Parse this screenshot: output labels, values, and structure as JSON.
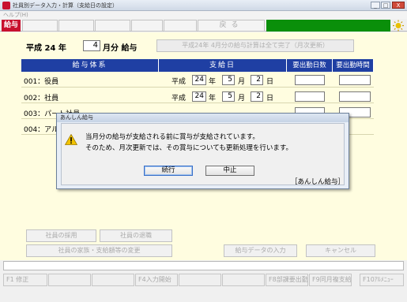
{
  "window": {
    "title": "社員別データ入力・計算（支給日の設定）",
    "menu_help": "ヘルプ(H)",
    "min": "_",
    "max": "□",
    "close": "X"
  },
  "toolbar": {
    "badge": "給与",
    "back_label": "戻る",
    "accent_color": "#0a8f0a"
  },
  "period": {
    "era": "平成",
    "year": "24",
    "year_unit": "年",
    "month": "4",
    "month_label": "月分 給与",
    "status": "平成24年 4月分の給与計算は全て完了（月次更新）"
  },
  "table": {
    "headers": {
      "system": "給与体系",
      "payday": "支給日",
      "days": "要出勤日数",
      "hours": "要出勤時間"
    },
    "rows": [
      {
        "name": "001：役員",
        "era": "平成",
        "year": "24",
        "month": "5",
        "day": "2"
      },
      {
        "name": "002：社員",
        "era": "平成",
        "year": "24",
        "month": "5",
        "day": "2"
      },
      {
        "name": "003：パート社員",
        "era": "",
        "year": "",
        "month": "",
        "day": ""
      },
      {
        "name": "004：アル",
        "era": "",
        "year": "",
        "month": "",
        "day": ""
      }
    ],
    "labels": {
      "year": "年",
      "month": "月",
      "day": "日"
    }
  },
  "actions": {
    "hire": "社員の採用",
    "retire": "社員の退職",
    "family": "社員の家族・支給額等の変更",
    "input": "給与データの入力",
    "cancel": "キャンセル"
  },
  "fkeys": [
    "F1 修正",
    "",
    "",
    "F4入力開始",
    "",
    "",
    "F8部課要出勤",
    "F9同月複支給",
    "F10ｱﾙﾒﾆｭｰ"
  ],
  "dialog": {
    "title": "あんしん給与",
    "line1": "当月分の給与が支給される前に賞与が支給されています。",
    "line2": "そのため、月次更新では、その賞与についても更新処理を行います。",
    "continue": "続行",
    "abort": "中止",
    "brand": "［あんしん給与］"
  }
}
